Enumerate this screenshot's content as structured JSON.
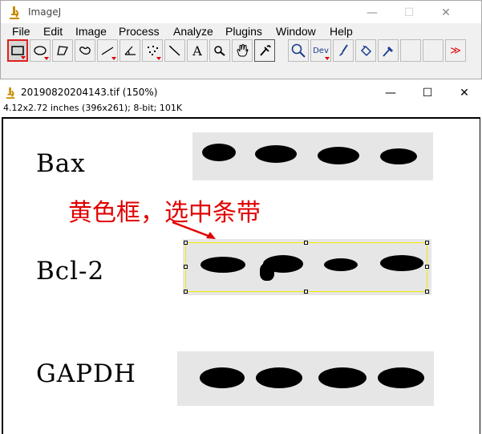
{
  "main_window": {
    "title": "ImageJ",
    "controls": {
      "minimize": "—",
      "maximize": "☐",
      "close": "✕"
    }
  },
  "menu": [
    "File",
    "Edit",
    "Image",
    "Process",
    "Analyze",
    "Plugins",
    "Window",
    "Help"
  ],
  "toolbar": {
    "tools": [
      {
        "name": "rectangle-tool",
        "selected": true
      },
      {
        "name": "oval-tool"
      },
      {
        "name": "polygon-tool"
      },
      {
        "name": "freehand-tool"
      },
      {
        "name": "line-tool"
      },
      {
        "name": "angle-tool"
      },
      {
        "name": "point-tool"
      },
      {
        "name": "wand-tool"
      },
      {
        "name": "text-tool",
        "glyph": "A"
      },
      {
        "name": "magnifier-tool"
      },
      {
        "name": "hand-tool"
      },
      {
        "name": "color-picker-tool"
      },
      {
        "name": "zoom-tool"
      },
      {
        "name": "dev-tool",
        "glyph": "Dev"
      },
      {
        "name": "brush-tool"
      },
      {
        "name": "flood-fill-tool"
      },
      {
        "name": "pickup-tool"
      },
      {
        "name": "more-tools",
        "glyph": "≫"
      }
    ],
    "accent_color": "#e02020"
  },
  "image_window": {
    "title": "20190820204143.tif (150%)",
    "info": "4.12x2.72 inches (396x261); 8-bit; 101K",
    "controls": {
      "minimize": "—",
      "maximize": "☐",
      "close": "✕"
    }
  },
  "blot_labels": [
    "Bax",
    "Bcl-2",
    "GAPDH"
  ],
  "annotation": {
    "text": "黄色框，选中条带",
    "color": "#e00000"
  },
  "roi": {
    "color": "#f4e800"
  }
}
